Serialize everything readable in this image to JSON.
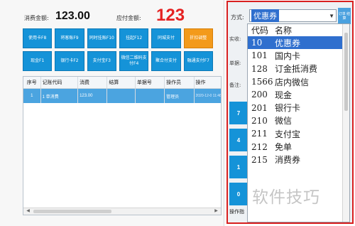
{
  "totals": {
    "consume_label": "消费金额:",
    "consume_value": "123.00",
    "due_label": "应付金额:",
    "due_value": "123"
  },
  "function_buttons": [
    [
      {
        "label": "使用卡F8"
      },
      {
        "label": "将客账F9"
      },
      {
        "label": "同时挂账F10"
      },
      {
        "label": "挂起F12"
      },
      {
        "label": "同城支付"
      },
      {
        "label": "折扣调整"
      }
    ],
    [
      {
        "label": "现金F1"
      },
      {
        "label": "银行卡F2"
      },
      {
        "label": "支付宝F3"
      },
      {
        "label": "微信二维码支付F4"
      },
      {
        "label": "聚合付支付"
      },
      {
        "label": "融通支付F7"
      }
    ]
  ],
  "grid": {
    "columns": [
      "序号",
      "记账代码",
      "消费",
      "结算",
      "单据号",
      "操作员",
      "操作"
    ],
    "rows": [
      {
        "seq": "1",
        "code": "1 单消费",
        "consume": "123.00",
        "settle": "",
        "bill": "",
        "operator": "管理员",
        "optime": "2020-12-0 11:48:20"
      }
    ]
  },
  "payment_panel": {
    "method_label": "方式:",
    "method_value": "优惠券",
    "side_button": "订单\n结算",
    "labels": [
      "实收:",
      "单据:",
      "备注:"
    ],
    "tile_numbers": [
      "7",
      "4",
      "1",
      "0"
    ],
    "operation_label": "操作指",
    "dropdown_header": {
      "code": "代码",
      "name": "名称"
    },
    "dropdown_items": [
      {
        "code": "10",
        "name": "优惠券",
        "selected": true
      },
      {
        "code": "101",
        "name": "国内卡",
        "selected": false
      },
      {
        "code": "128",
        "name": "订金抵消费",
        "selected": false
      },
      {
        "code": "1566",
        "name": "店内微信",
        "selected": false
      },
      {
        "code": "200",
        "name": "现金",
        "selected": false
      },
      {
        "code": "201",
        "name": "银行卡",
        "selected": false
      },
      {
        "code": "210",
        "name": "微信",
        "selected": false
      },
      {
        "code": "211",
        "name": "支付宝",
        "selected": false
      },
      {
        "code": "212",
        "name": "免单",
        "selected": false
      },
      {
        "code": "215",
        "name": "消费券",
        "selected": false
      }
    ]
  },
  "watermark": "软件技巧"
}
